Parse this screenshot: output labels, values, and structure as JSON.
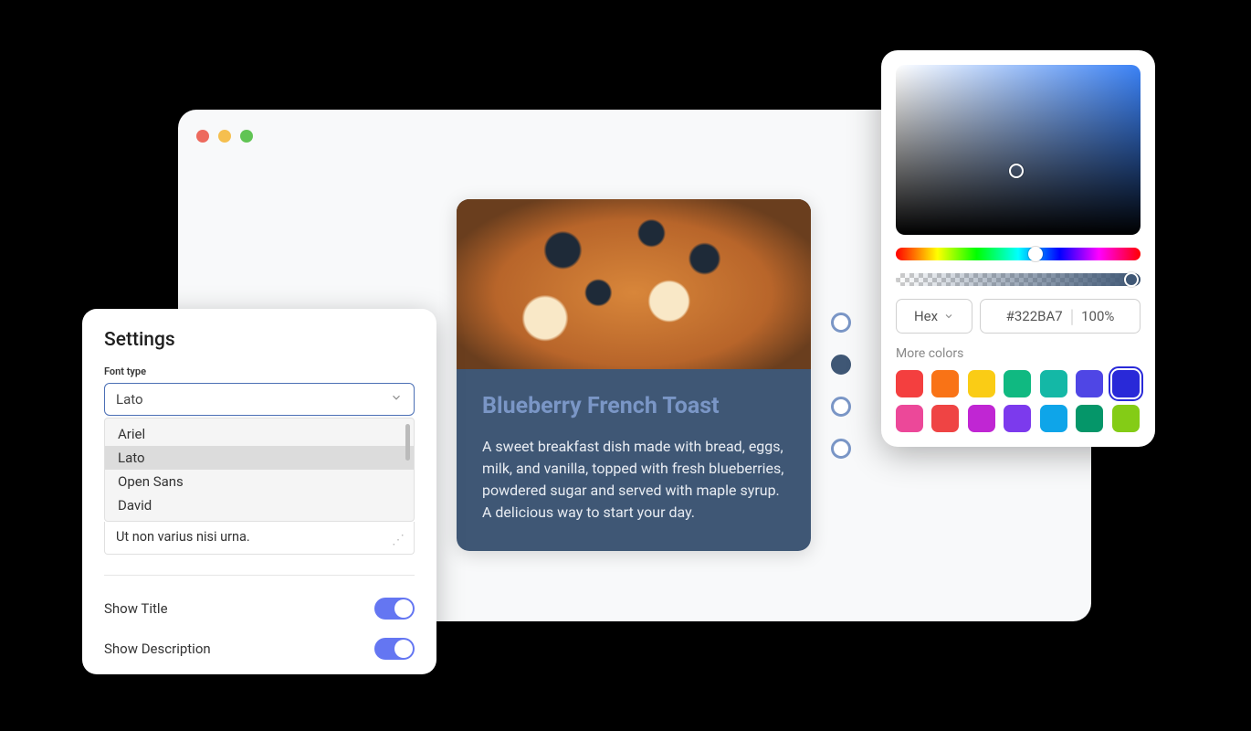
{
  "card": {
    "title": "Blueberry French Toast",
    "description": "A sweet breakfast dish made with bread, eggs, milk, and vanilla, topped with fresh blueberries, powdered sugar and served with maple syrup. A delicious way to start your day."
  },
  "settings": {
    "title": "Settings",
    "font_label": "Font type",
    "font_value": "Lato",
    "font_options": [
      "Ariel",
      "Lato",
      "Open Sans",
      "David"
    ],
    "font_selected_index": 1,
    "textarea_value": "Ut non varius nisi urna.",
    "toggles": [
      {
        "label": "Show Title",
        "on": true
      },
      {
        "label": "Show Description",
        "on": true
      }
    ]
  },
  "picker": {
    "format": "Hex",
    "hex": "#322BA7",
    "opacity": "100%",
    "more_label": "More colors",
    "swatches_row1": [
      "#f43f3f",
      "#f97316",
      "#facc15",
      "#10b981",
      "#14b8a6",
      "#4f46e5",
      "#2929d8"
    ],
    "swatches_row2": [
      "#ec4899",
      "#ef4444",
      "#c026d3",
      "#7c3aed",
      "#0ea5e9",
      "#059669",
      "#84cc16"
    ],
    "selected_swatch_index": 6
  },
  "scheme": {
    "dots": [
      false,
      true,
      false,
      false
    ]
  }
}
